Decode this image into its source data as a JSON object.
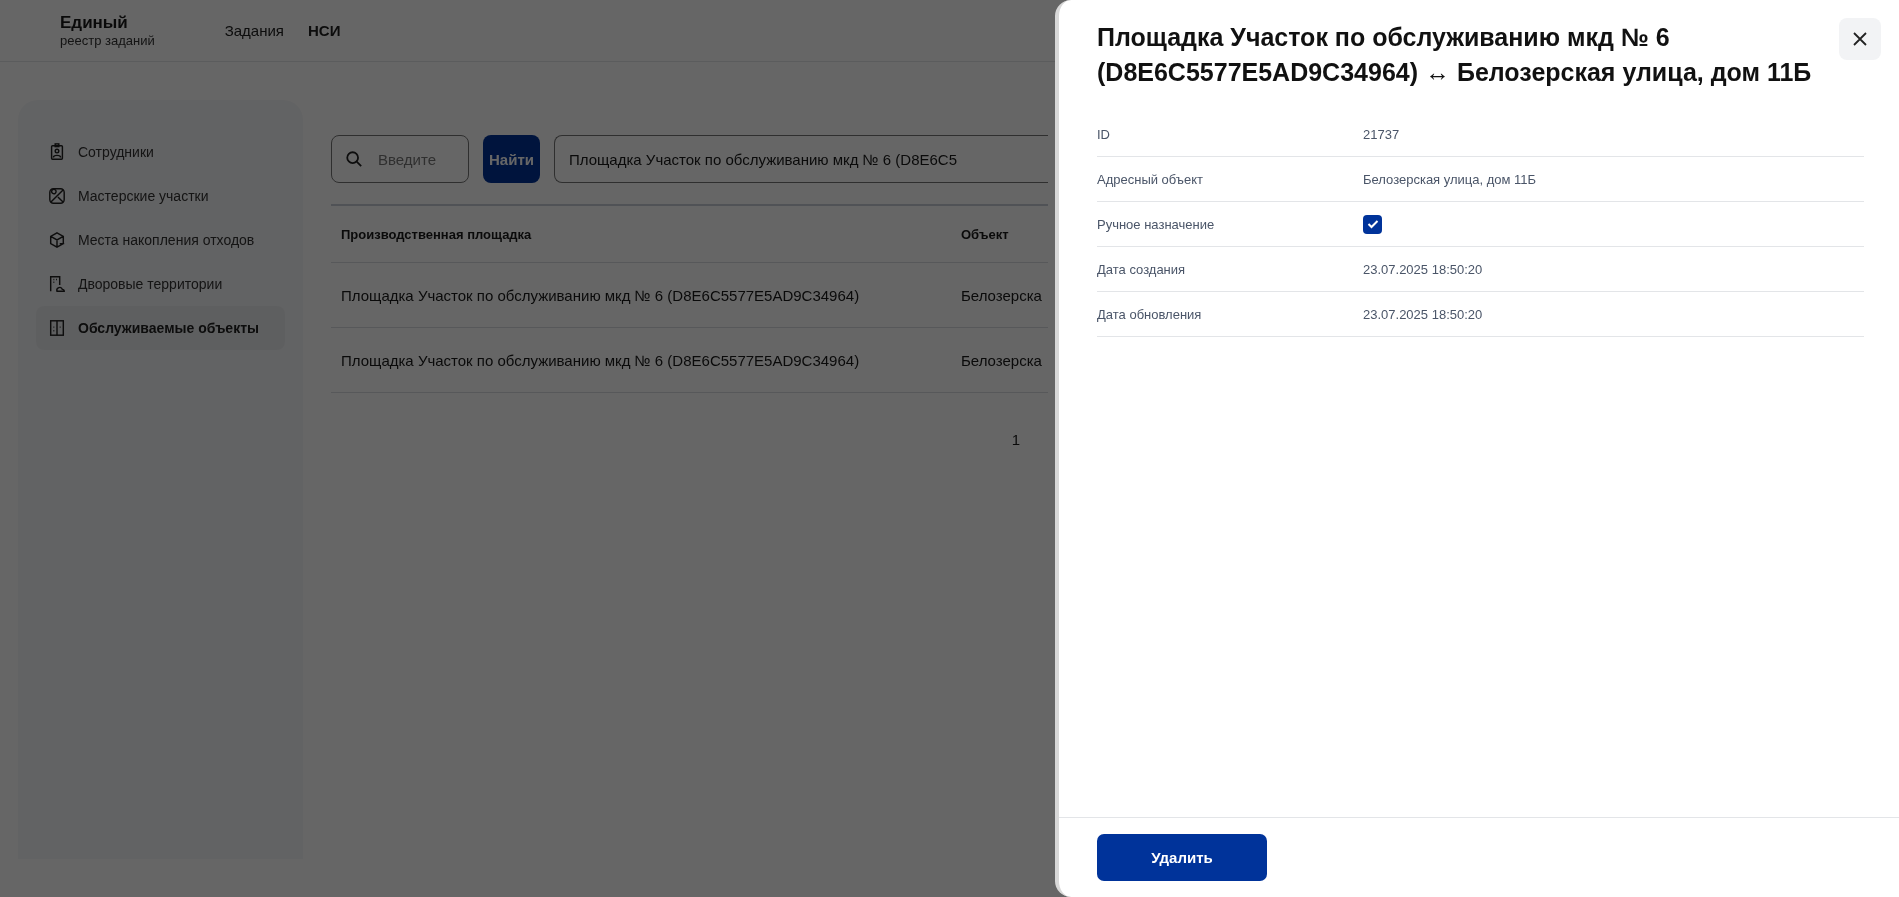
{
  "header": {
    "logo_title": "Единый",
    "logo_subtitle": "реестр заданий",
    "nav": [
      {
        "label": "Задания",
        "selected": false
      },
      {
        "label": "НСИ",
        "selected": true
      }
    ]
  },
  "sidebar": {
    "items": [
      {
        "label": "Сотрудники",
        "kind": "badge",
        "selected": false
      },
      {
        "label": "Мастерские участки",
        "kind": "map",
        "selected": false
      },
      {
        "label": "Места накопления отходов",
        "kind": "box",
        "selected": false
      },
      {
        "label": "Дворовые территории",
        "kind": "yard",
        "selected": false
      },
      {
        "label": "Обслуживаемые объекты",
        "kind": "building",
        "selected": true
      }
    ]
  },
  "search": {
    "placeholder": "Введите",
    "button": "Найти"
  },
  "filter": {
    "value": "Площадка Участок по обслуживанию мкд № 6 (D8E6C5"
  },
  "table": {
    "columns": [
      "Производственная площадка",
      "Объект"
    ],
    "rows": [
      [
        "Площадка Участок по обслуживанию мкд № 6 (D8E6C5577E5AD9C34964)",
        "Белозерска"
      ],
      [
        "Площадка Участок по обслуживанию мкд № 6 (D8E6C5577E5AD9C34964)",
        "Белозерска"
      ]
    ]
  },
  "pagination": [
    "1"
  ],
  "drawer": {
    "title": "Площадка Участок по обслуживанию мкд № 6 (D8E6C5577E5AD9C34964) ↔ Белозерская улица, дом 11Б",
    "fields": [
      {
        "label": "ID",
        "kind": "text",
        "value": "21737"
      },
      {
        "label": "Адресный объект",
        "kind": "text",
        "value": "Белозерская улица, дом 11Б"
      },
      {
        "label": "Ручное назначение",
        "kind": "checkbox",
        "checked": true
      },
      {
        "label": "Дата создания",
        "kind": "text",
        "value": "23.07.2025 18:50:20"
      },
      {
        "label": "Дата обновления",
        "kind": "text",
        "value": "23.07.2025 18:50:20"
      }
    ],
    "delete_button": "Удалить"
  }
}
